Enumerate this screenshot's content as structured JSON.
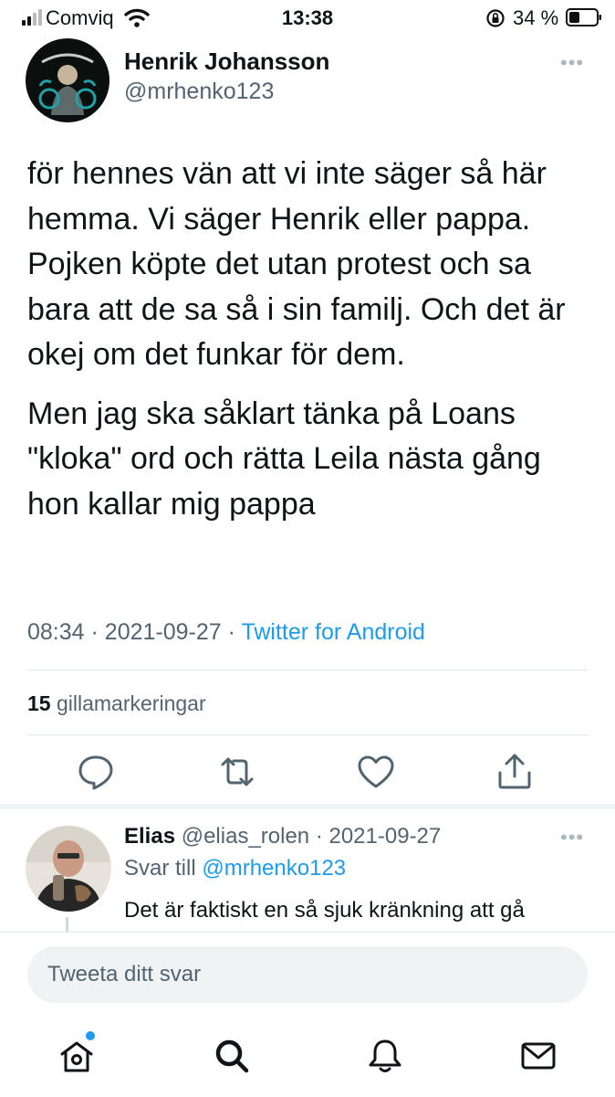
{
  "status_bar": {
    "carrier": "Comviq",
    "time": "13:38",
    "battery": "34 %"
  },
  "tweet": {
    "author_name": "Henrik Johansson",
    "author_handle": "@mrhenko123",
    "paragraphs": [
      "för hennes vän att vi inte säger så här hemma. Vi säger Henrik eller pappa. Pojken köpte det utan protest och sa bara att de sa så i sin familj. Och det är okej om det funkar för dem.",
      "Men jag ska såklart tänka på Loans \"kloka\" ord och rätta Leila nästa gång hon kallar mig pappa"
    ],
    "time": "08:34",
    "date": "2021-09-27",
    "separator": "·",
    "source": "Twitter for Android",
    "like_count": "15",
    "like_label": "gillamarkeringar",
    "more_glyph": "•••"
  },
  "reply": {
    "name": "Elias",
    "handle": "@elias_rolen",
    "date": "· 2021-09-27",
    "reply_to_label": "Svar till",
    "reply_to_handle": "@mrhenko123",
    "text": "Det är faktiskt en så sjuk kränkning att gå"
  },
  "compose": {
    "placeholder": "Tweeta ditt svar"
  },
  "colors": {
    "accent": "#1d9bf0",
    "secondary_text": "#536471",
    "divider": "#e1e8ed"
  },
  "icons": {
    "actions": [
      "reply-icon",
      "retweet-icon",
      "like-icon",
      "share-icon"
    ],
    "nav": [
      "home-icon",
      "search-icon",
      "notifications-icon",
      "messages-icon"
    ]
  }
}
